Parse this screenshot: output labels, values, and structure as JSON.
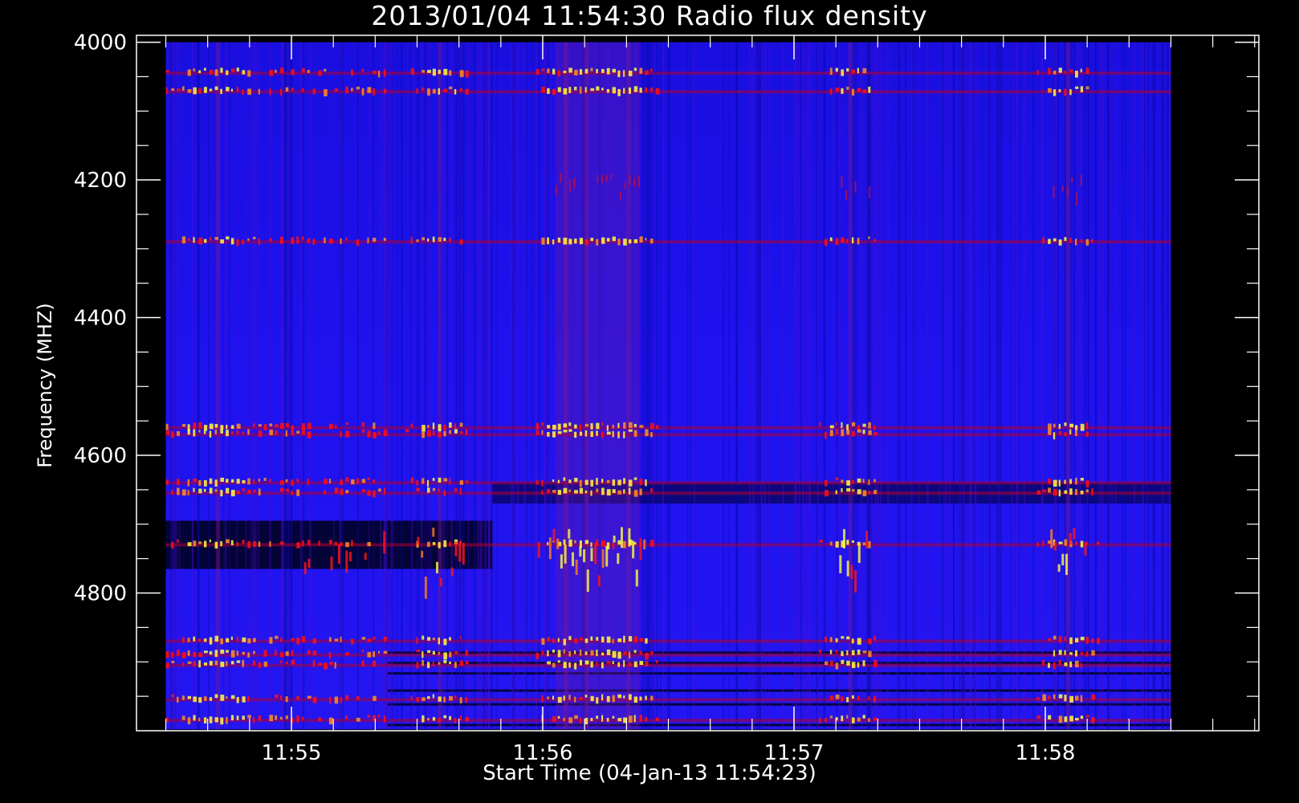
{
  "chart_data": {
    "type": "heatmap",
    "title": "2013/01/04 11:54:30 Radio flux density",
    "xlabel": "Start Time (04-Jan-13 11:54:23)",
    "ylabel": "Frequency (MHZ)",
    "x_tick_labels": [
      "11:55",
      "11:56",
      "11:57",
      "11:58"
    ],
    "x_tick_values_seconds": [
      37,
      97,
      157,
      217
    ],
    "xlim_seconds": [
      0,
      268
    ],
    "data_x_range_seconds": [
      7,
      247
    ],
    "y_tick_values": [
      4000,
      4200,
      4400,
      4600,
      4800
    ],
    "ylim": [
      3990,
      5000
    ],
    "data_y_range": [
      4000,
      4998
    ],
    "y_reversed": true,
    "colormap": [
      "#000000",
      "#0000ff",
      "#ff0000",
      "#ffff00"
    ],
    "bright_bands_mhz": [
      4045,
      4072,
      4290,
      4560,
      4570,
      4640,
      4655,
      4730,
      4870,
      4890,
      4905,
      4955,
      4985
    ],
    "burst_times_seconds": [
      19,
      72,
      102,
      107,
      117,
      170,
      222
    ]
  }
}
